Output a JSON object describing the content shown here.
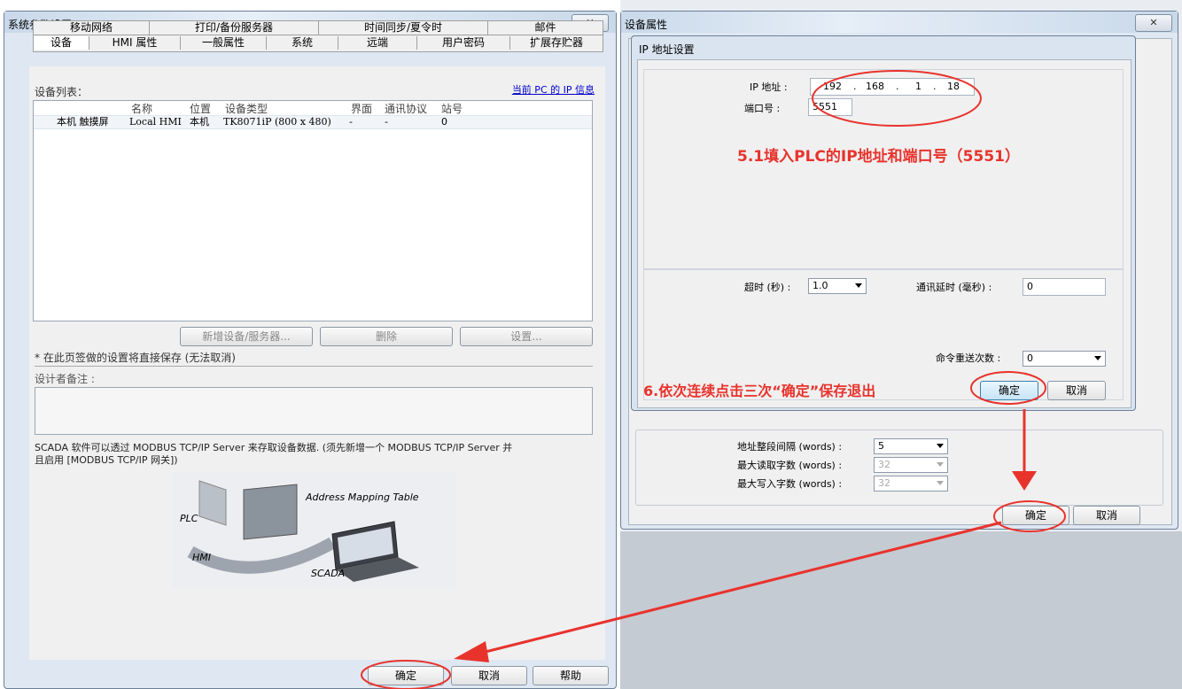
{
  "left_window": {
    "title": "系统参数设置",
    "tabs_top": [
      "移动网络",
      "打印/备份服务器",
      "时间同步/夏令时",
      "邮件"
    ],
    "tabs_bottom": [
      "设备",
      "HMI 属性",
      "一般属性",
      "系统",
      "远端",
      "用户密码",
      "扩展存贮器"
    ],
    "device_list_label": "设备列表：",
    "pc_ip_link": "当前 PC 的 IP 信息",
    "table": {
      "headers": [
        "名称",
        "位置",
        "设备类型",
        "界面",
        "通讯协议",
        "站号"
      ],
      "rows": [
        [
          "本机 触摸屏",
          "Local HMI",
          "本机",
          "TK8071iP (800 x 480)",
          "-",
          "-",
          "0"
        ]
      ]
    },
    "buttons": {
      "add": "新增设备/服务器...",
      "delete": "删除",
      "settings": "设置..."
    },
    "note_save": "* 在此页签做的设置将直接保存 (无法取消)",
    "designer_note_label": "设计者备注 :",
    "scada_text_1": "SCADA 软件可以透过 MODBUS TCP/IP Server 来存取设备数据. (须先新增一个 MODBUS TCP/IP Server 并",
    "scada_text_2": "且启用 [MODBUS TCP/IP 网关])",
    "diagram": {
      "mapping": "Address Mapping Table",
      "plc": "PLC",
      "hmi": "HMI",
      "scada": "SCADA"
    },
    "footer": {
      "ok": "确定",
      "cancel": "取消",
      "help": "帮助"
    }
  },
  "right_window": {
    "title": "设备属性",
    "address_block": {
      "interval_label": "地址整段间隔 (words) :",
      "interval_value": "5",
      "max_read_label": "最大读取字数 (words) :",
      "max_read_value": "32",
      "max_write_label": "最大写入字数 (words) :",
      "max_write_value": "32"
    },
    "footer": {
      "ok": "确定",
      "cancel": "取消"
    }
  },
  "ip_dialog": {
    "title": "IP 地址设置",
    "ip_label": "IP 地址 :",
    "ip_octets": [
      "192",
      "168",
      "1",
      "18"
    ],
    "port_label": "端口号 :",
    "port_value": "5551",
    "timeout_label": "超时 (秒) :",
    "timeout_value": "1.0",
    "delay_label": "通讯延时 (毫秒) :",
    "delay_value": "0",
    "retry_label": "命令重送次数 :",
    "retry_value": "0",
    "ok": "确定",
    "cancel": "取消"
  },
  "annotations": {
    "step1": "5.1填入PLC的IP地址和端口号（5551）",
    "step2": "6.依次连续点击三次“确定”保存退出",
    "color": "#e8332d"
  }
}
